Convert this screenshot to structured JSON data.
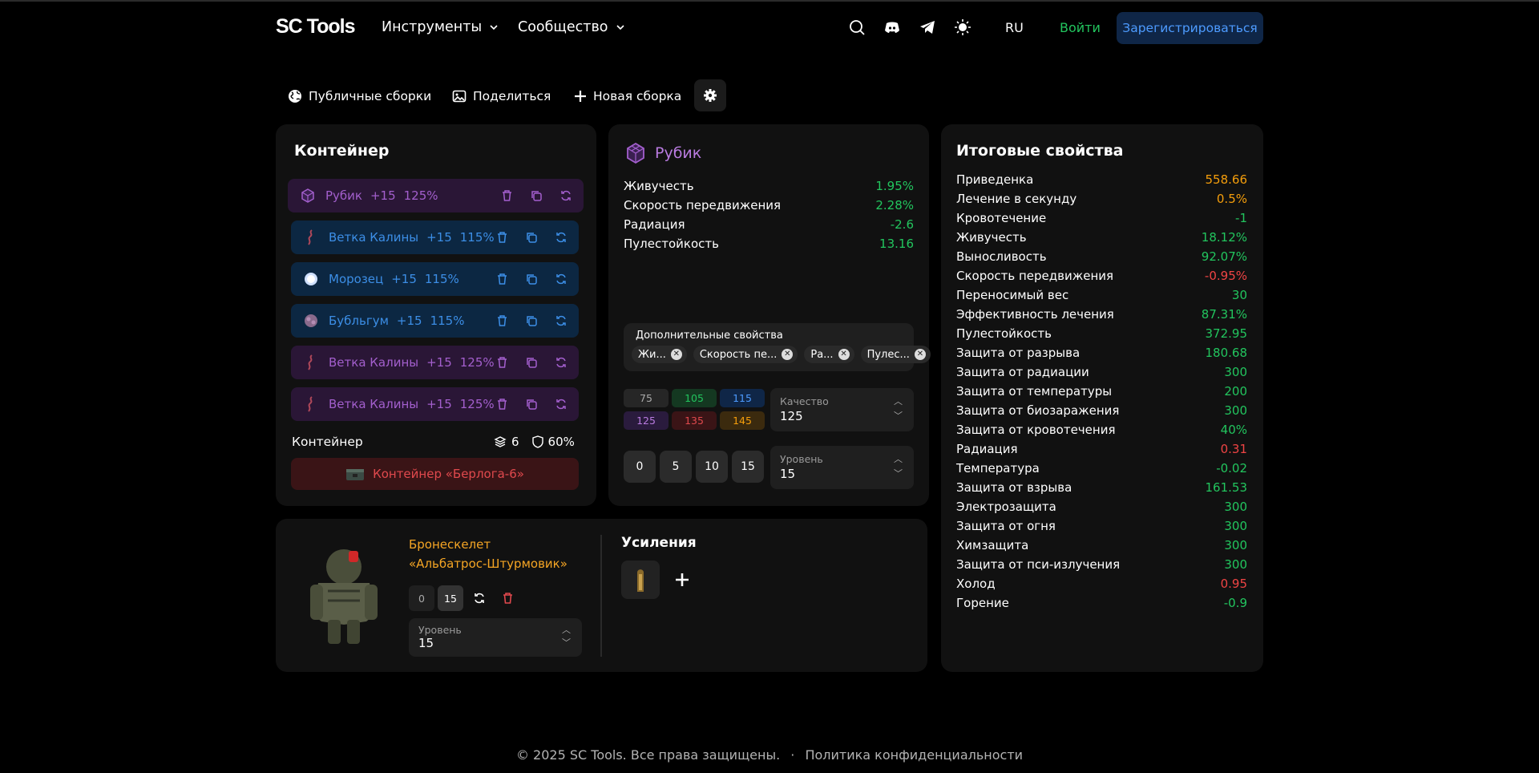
{
  "header": {
    "logo": "SC Tools",
    "nav_tools": "Инструменты",
    "nav_community": "Сообщество",
    "lang": "RU",
    "login": "Войти",
    "register": "Зарегистрироваться"
  },
  "toolbar": {
    "public_builds": "Публичные сборки",
    "share": "Поделиться",
    "new_build": "Новая сборка"
  },
  "container_panel": {
    "title": "Контейнер",
    "artifacts": [
      {
        "name": "Рубик",
        "plus": "+15",
        "quality": "125%"
      },
      {
        "name": "Ветка Калины",
        "plus": "+15",
        "quality": "115%"
      },
      {
        "name": "Морозец",
        "plus": "+15",
        "quality": "115%"
      },
      {
        "name": "Бубльгум",
        "plus": "+15",
        "quality": "115%"
      },
      {
        "name": "Ветка Калины",
        "plus": "+15",
        "quality": "125%"
      },
      {
        "name": "Ветка Калины",
        "plus": "+15",
        "quality": "125%"
      }
    ],
    "footer_label": "Контейнер",
    "slots": "6",
    "protection": "60%",
    "container_name": "Контейнер «Берлога-6»"
  },
  "artifact_panel": {
    "title": "Рубик",
    "stats": [
      {
        "label": "Живучесть",
        "value": "1.95%"
      },
      {
        "label": "Скорость передвижения",
        "value": "2.28%"
      },
      {
        "label": "Радиация",
        "value": "-2.6"
      },
      {
        "label": "Пулестойкость",
        "value": "13.16"
      }
    ],
    "extra_title": "Дополнительные свойства",
    "extra_chips": [
      "Жи...",
      "Скорость пе...",
      "Ра...",
      "Пулес..."
    ],
    "quality_options": [
      "75",
      "105",
      "115",
      "125",
      "135",
      "145"
    ],
    "quality_label": "Качество",
    "quality_value": "125",
    "level_options": [
      "0",
      "5",
      "10",
      "15"
    ],
    "level_label": "Уровень",
    "level_value": "15"
  },
  "armor_panel": {
    "name_line1": "Бронескелет",
    "name_line2": "«Альбатрос-Штурмовик»",
    "level_min": "0",
    "level_max": "15",
    "level_label": "Уровень",
    "level_value": "15",
    "boosts_title": "Усиления"
  },
  "totals": {
    "title": "Итоговые свойства",
    "rows": [
      {
        "label": "Приведенка",
        "value": "558.66",
        "color": "#f59e0b"
      },
      {
        "label": "Лечение в секунду",
        "value": "0.5%",
        "color": "#f59e0b"
      },
      {
        "label": "Кровотечение",
        "value": "-1",
        "color": "#22c55e"
      },
      {
        "label": "Живучесть",
        "value": "18.12%",
        "color": "#22c55e"
      },
      {
        "label": "Выносливость",
        "value": "92.07%",
        "color": "#22c55e"
      },
      {
        "label": "Скорость передвижения",
        "value": "-0.95%",
        "color": "#ef4444"
      },
      {
        "label": "Переносимый вес",
        "value": "30",
        "color": "#22c55e"
      },
      {
        "label": "Эффективность лечения",
        "value": "87.31%",
        "color": "#22c55e"
      },
      {
        "label": "Пулестойкость",
        "value": "372.95",
        "color": "#22c55e"
      },
      {
        "label": "Защита от разрыва",
        "value": "180.68",
        "color": "#22c55e"
      },
      {
        "label": "Защита от радиации",
        "value": "300",
        "color": "#22c55e"
      },
      {
        "label": "Защита от температуры",
        "value": "200",
        "color": "#22c55e"
      },
      {
        "label": "Защита от биозаражения",
        "value": "300",
        "color": "#22c55e"
      },
      {
        "label": "Защита от кровотечения",
        "value": "40%",
        "color": "#22c55e"
      },
      {
        "label": "Радиация",
        "value": "0.31",
        "color": "#ef4444"
      },
      {
        "label": "Температура",
        "value": "-0.02",
        "color": "#22c55e"
      },
      {
        "label": "Защита от взрыва",
        "value": "161.53",
        "color": "#22c55e"
      },
      {
        "label": "Электрозащита",
        "value": "300",
        "color": "#22c55e"
      },
      {
        "label": "Защита от огня",
        "value": "300",
        "color": "#22c55e"
      },
      {
        "label": "Химзащита",
        "value": "300",
        "color": "#22c55e"
      },
      {
        "label": "Защита от пси-излучения",
        "value": "300",
        "color": "#22c55e"
      },
      {
        "label": "Холод",
        "value": "0.95",
        "color": "#ef4444"
      },
      {
        "label": "Горение",
        "value": "-0.9",
        "color": "#22c55e"
      }
    ]
  },
  "footer": {
    "copyright": "© 2025 SC Tools. Все права защищены.",
    "sep": "·",
    "privacy": "Политика конфиденциальности"
  }
}
